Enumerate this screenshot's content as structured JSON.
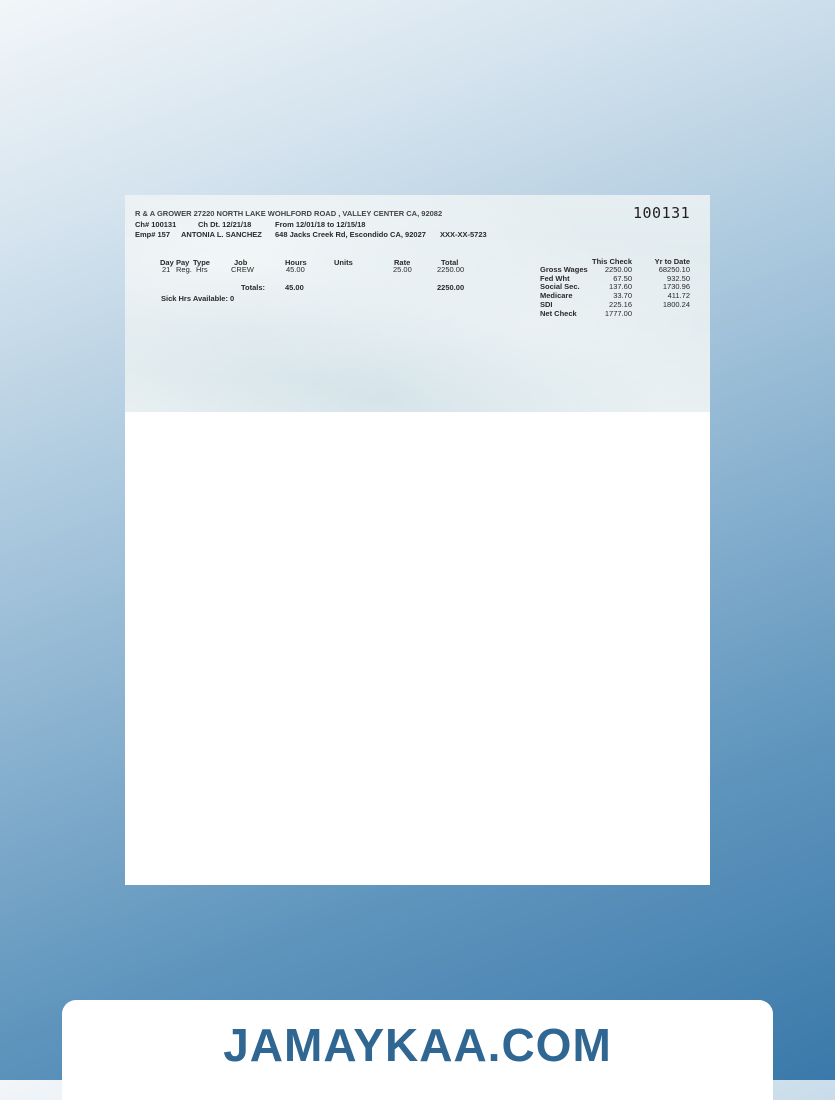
{
  "header": {
    "company_line": "R & A GROWER 27220 NORTH LAKE WOHLFORD ROAD , VALLEY CENTER CA,  92082",
    "check_number": "100131",
    "ch_no": "Ch# 100131",
    "ch_date": "Ch Dt. 12/21/18",
    "period": "From 12/01/18 to 12/15/18",
    "emp_no": "Emp# 157",
    "employee_name": "ANTONIA L. SANCHEZ",
    "employee_address": "648 Jacks Creek Rd, Escondido CA, 92027",
    "ssn": "XXX-XX-5723"
  },
  "earnings": {
    "columns": {
      "day": "Day",
      "pay": "Pay",
      "type": "Type",
      "job": "Job",
      "hours": "Hours",
      "units": "Units",
      "rate": "Rate",
      "total": "Total"
    },
    "rows": [
      {
        "day": "21",
        "pay": "Reg.",
        "type": "Hrs",
        "job": "CREW",
        "hours": "45.00",
        "units": "",
        "rate": "25.00",
        "total": "2250.00"
      }
    ],
    "totals_label": "Totals:",
    "totals_hours": "45.00",
    "totals_amount": "2250.00",
    "sick_hours": "Sick Hrs Available: 0"
  },
  "summary": {
    "col_this_check": "This Check",
    "col_ytd": "Yr to Date",
    "rows": [
      {
        "label": "Gross Wages",
        "this_check": "2250.00",
        "ytd": "68250.10"
      },
      {
        "label": "Fed Wht",
        "this_check": "67.50",
        "ytd": "932.50"
      },
      {
        "label": "Social Sec.",
        "this_check": "137.60",
        "ytd": "1730.96"
      },
      {
        "label": "Medicare",
        "this_check": "33.70",
        "ytd": "411.72"
      },
      {
        "label": "SDI",
        "this_check": "225.16",
        "ytd": "1800.24"
      },
      {
        "label": "Net Check",
        "this_check": "1777.00",
        "ytd": ""
      }
    ]
  },
  "footer": {
    "brand": "JAMAYKAA.COM"
  }
}
